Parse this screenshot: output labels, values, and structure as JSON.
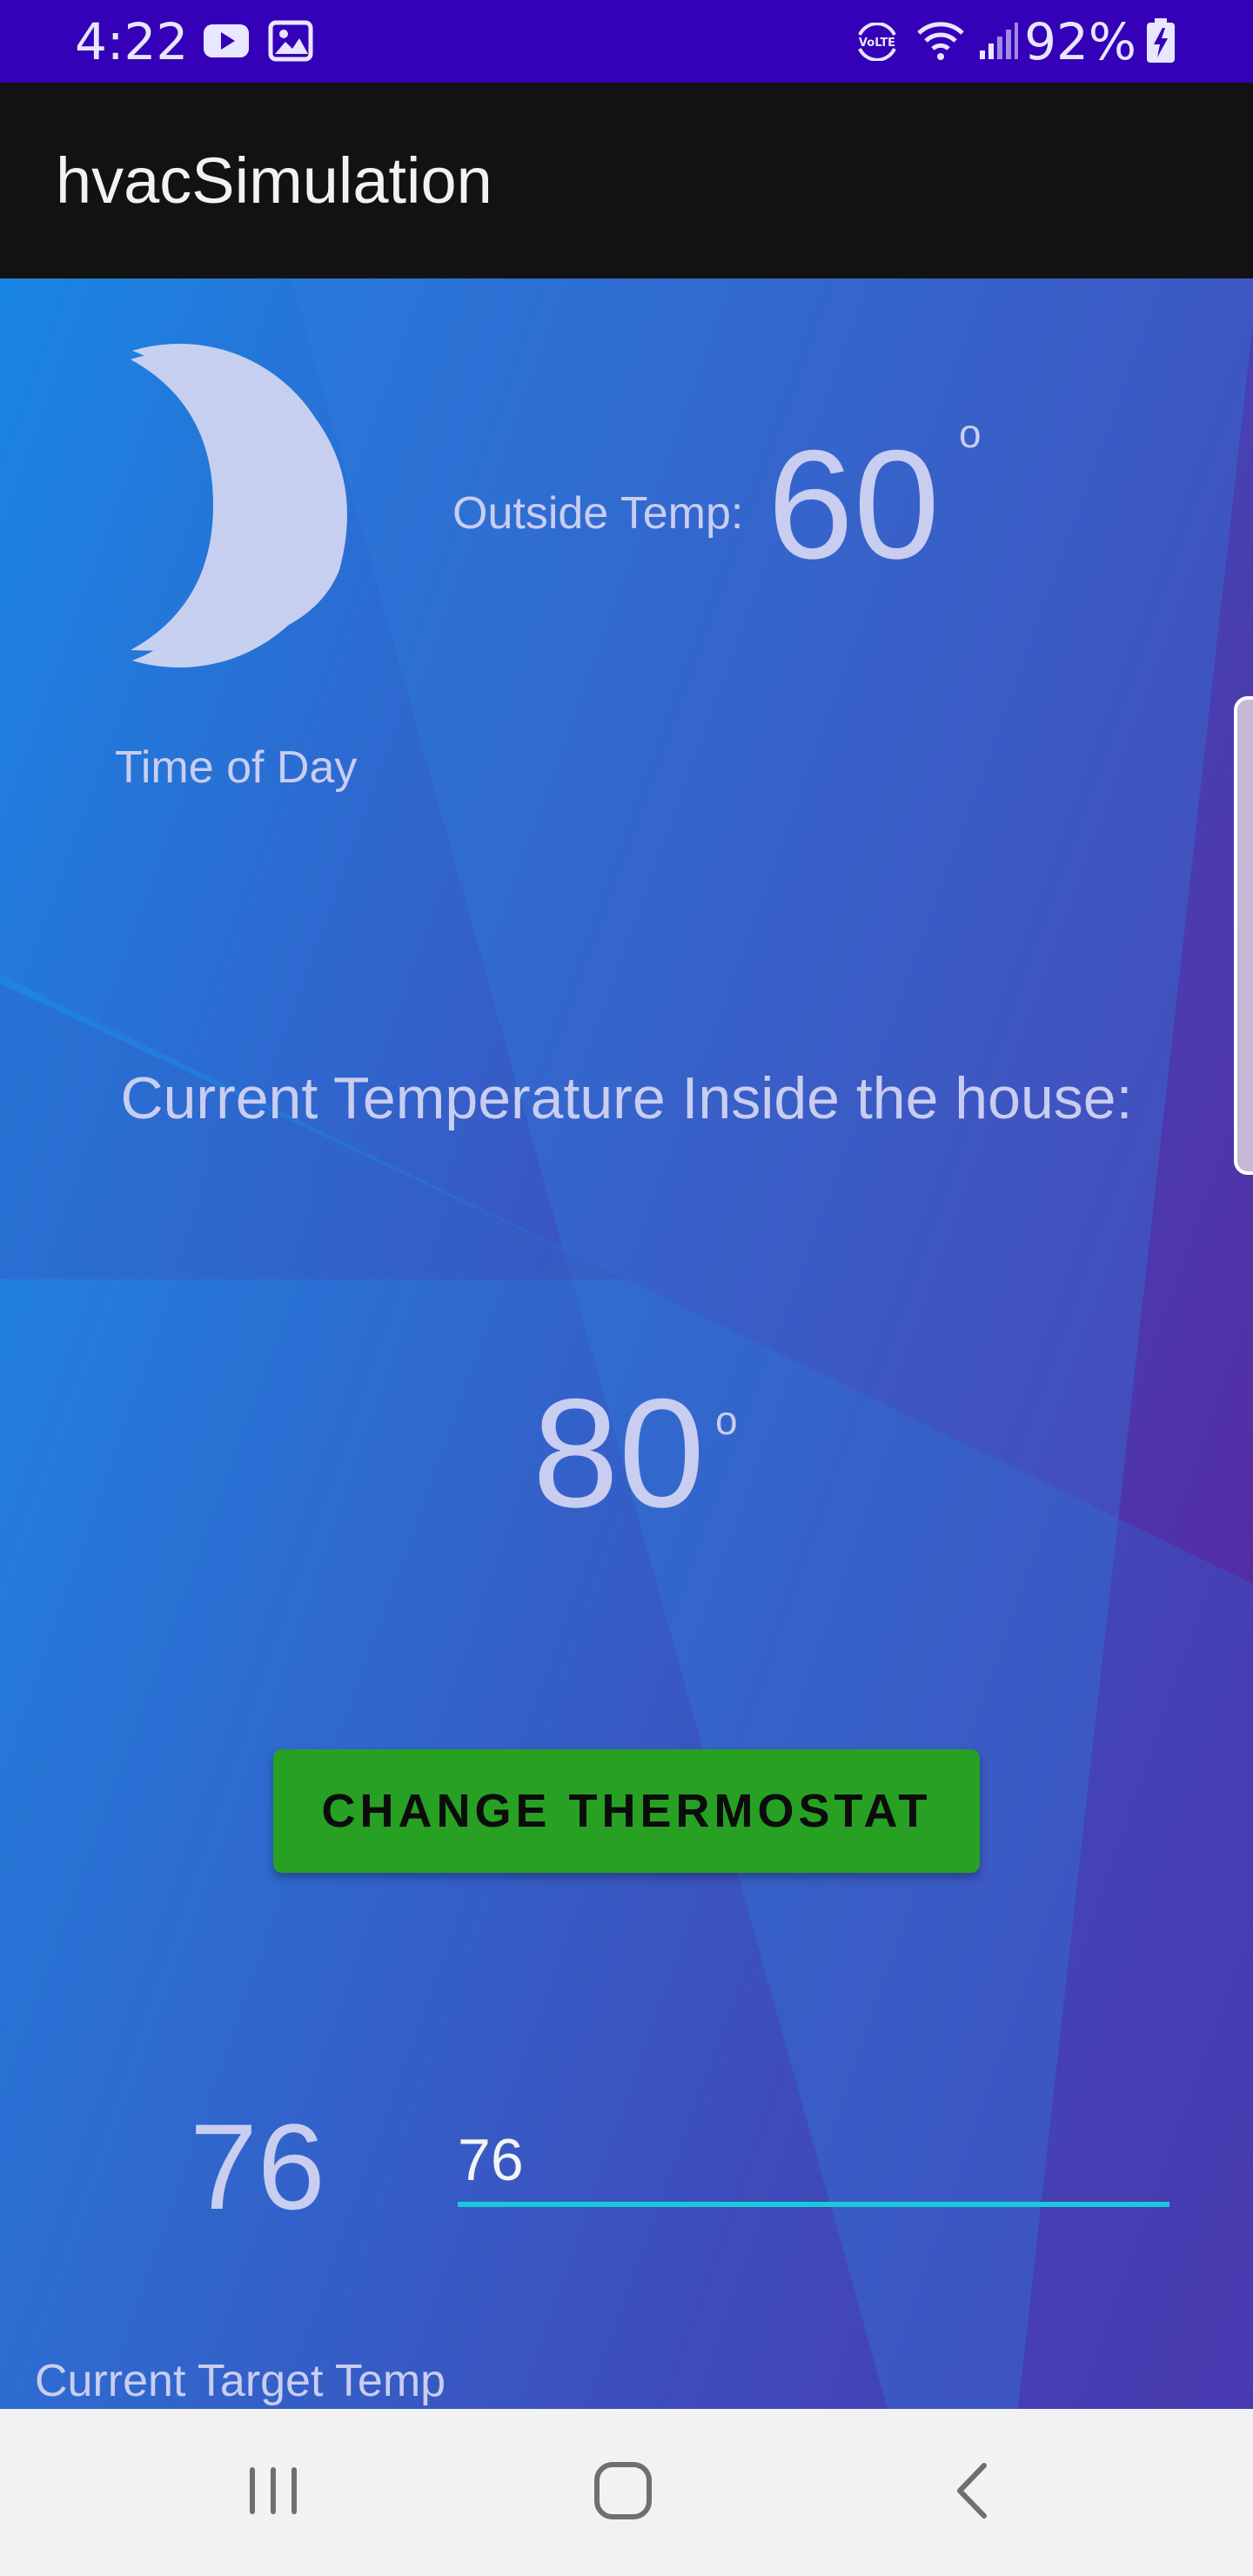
{
  "status_bar": {
    "time": "4:22",
    "battery_percent": "92%",
    "icons": [
      "youtube-icon",
      "gallery-icon",
      "volte-icon",
      "wifi-icon",
      "signal-icon",
      "battery-charging-icon"
    ]
  },
  "app_bar": {
    "title": "hvacSimulation"
  },
  "time_of_day": {
    "icon": "moon-icon",
    "label": "Time of Day"
  },
  "outside": {
    "label": "Outside Temp:",
    "value": "60",
    "degree": "o"
  },
  "inside": {
    "heading": "Current Temperature Inside the house:",
    "value": "80",
    "degree": "o"
  },
  "thermostat_button": {
    "label": "CHANGE THERMOSTAT",
    "color": "#27a024"
  },
  "target": {
    "value": "76",
    "input_value": "76",
    "label": "Current Target Temp",
    "underline_color": "#17c9d9"
  },
  "nav_bar": {
    "buttons": [
      "recent-apps-icon",
      "home-icon",
      "back-icon"
    ]
  },
  "colors": {
    "status_bar": "#3400b8",
    "app_bar": "#121212",
    "gradient_start": "#1a86e4",
    "gradient_end": "#5b1f9e",
    "text_light": "#c9cdf0"
  }
}
